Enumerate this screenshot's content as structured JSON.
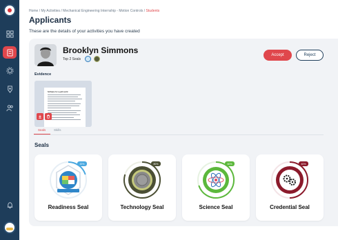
{
  "sidebar": {
    "items": [
      {
        "name": "logo-icon"
      },
      {
        "name": "dashboard-icon"
      },
      {
        "name": "activities-icon",
        "active": true
      },
      {
        "name": "settings-icon"
      },
      {
        "name": "badge-icon"
      },
      {
        "name": "users-icon"
      },
      {
        "name": "bell-icon"
      }
    ]
  },
  "breadcrumb": {
    "path": "Home / My Activities / Mechanical Engineering Internship - Motion Controls / ",
    "current": "Students"
  },
  "page": {
    "title": "Applicants",
    "subtitle": "These are the details of your activities you have created"
  },
  "applicant": {
    "name": "Brooklyn Simmons",
    "top_seals_label": "Top 2 Seals"
  },
  "actions": {
    "accept_label": "Accept",
    "reject_label": "Reject"
  },
  "evidence": {
    "label": "Evidence",
    "doc_title": "Software for a grid world"
  },
  "tabs": [
    {
      "label": "Seals",
      "active": true
    },
    {
      "label": "Skills",
      "active": false
    }
  ],
  "seals_heading": "Seals",
  "seals": [
    {
      "name": "Readiness Seal",
      "percent": "20%",
      "color": "#4aa8e0"
    },
    {
      "name": "Technology Seal",
      "percent": "80%",
      "color": "#4b4f34"
    },
    {
      "name": "Science Seal",
      "percent": "60%",
      "color": "#5cb83c"
    },
    {
      "name": "Credential Seal",
      "percent": "40%",
      "color": "#8b1a2b"
    }
  ],
  "colors": {
    "accent": "#e0474c",
    "sidebar": "#1e3d5a"
  }
}
